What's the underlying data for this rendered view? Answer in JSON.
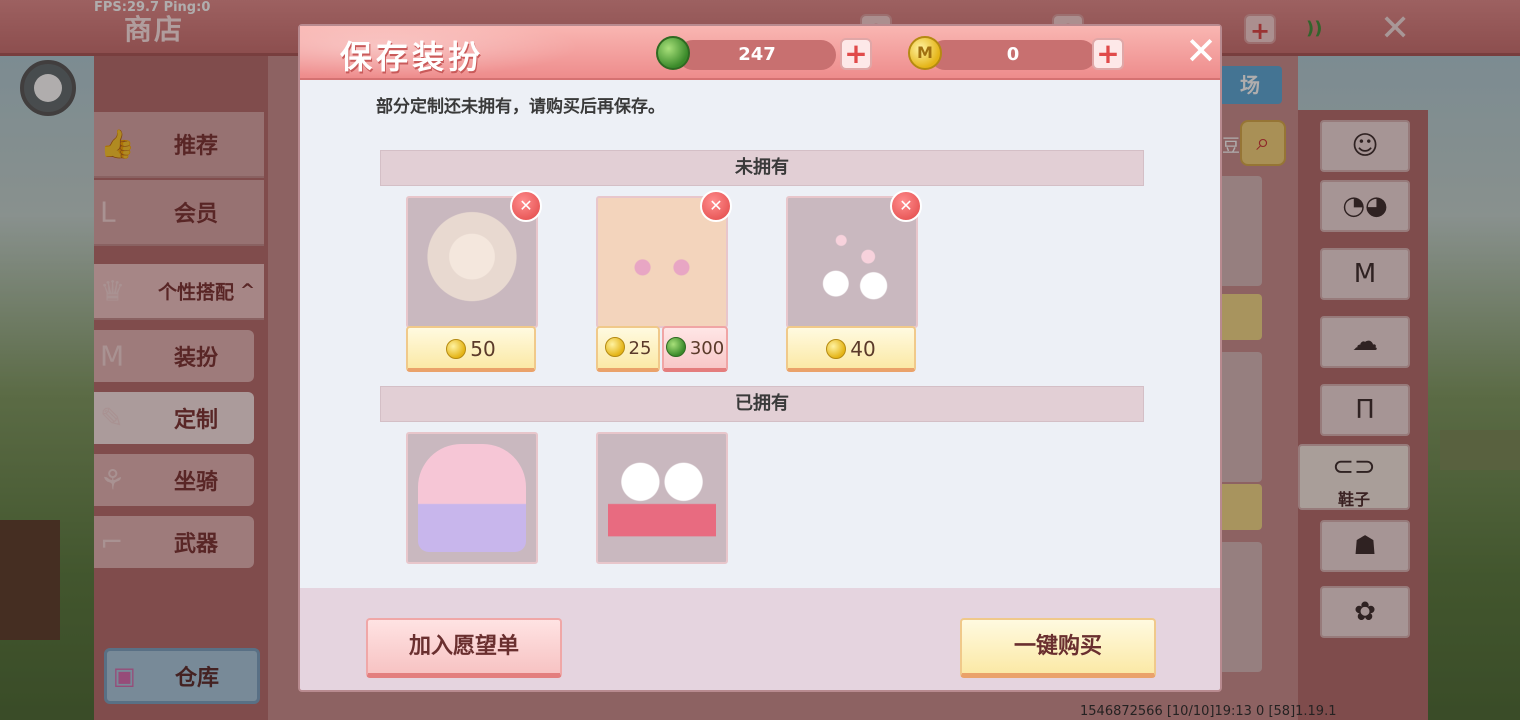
{
  "hud": {
    "fps_text": "FPS:29.7  Ping:0"
  },
  "shop": {
    "title": "商店",
    "sidebar": [
      {
        "label": "推荐",
        "icon": "thumbs-up-icon"
      },
      {
        "label": "会员",
        "icon": "vip-icon"
      },
      {
        "label": "个性搭配",
        "icon": "crown-icon",
        "expanded": true
      },
      {
        "label": "装扮",
        "icon": "shirt-icon"
      },
      {
        "label": "定制",
        "icon": "brush-icon"
      },
      {
        "label": "坐骑",
        "icon": "mount-icon"
      },
      {
        "label": "武器",
        "icon": "gun-icon"
      }
    ],
    "warehouse_label": "仓库",
    "tab_right": "场",
    "search_side_text": "豆",
    "categories": [
      {
        "icon": "face-icon"
      },
      {
        "icon": "mask-icon"
      },
      {
        "icon": "shirt-icon"
      },
      {
        "icon": "hair-icon"
      },
      {
        "icon": "pants-icon"
      },
      {
        "icon": "shoes-icon",
        "label": "鞋子",
        "active": true
      },
      {
        "icon": "backpack-icon"
      },
      {
        "icon": "paw-icon"
      }
    ],
    "status_text": "1546872566    [10/10]19:13 0      [58]1.19.1"
  },
  "modal": {
    "title": "保存装扮",
    "gems": "247",
    "coins": "0",
    "coin_symbol": "M",
    "hint": "部分定制还未拥有，请购买后再保存。",
    "not_owned_label": "未拥有",
    "owned_label": "已拥有",
    "not_owned_items": [
      {
        "name": "bunny-hair",
        "prices": [
          {
            "currency": "coin",
            "value": "50"
          }
        ]
      },
      {
        "name": "cute-face",
        "prices": [
          {
            "currency": "coin",
            "value": "25"
          },
          {
            "currency": "gem",
            "value": "300"
          }
        ]
      },
      {
        "name": "paw-effect",
        "prices": [
          {
            "currency": "coin",
            "value": "40"
          }
        ]
      }
    ],
    "owned_items": [
      {
        "name": "pink-dress"
      },
      {
        "name": "cat-shoes"
      }
    ],
    "wishlist_label": "加入愿望单",
    "buy_all_label": "一键购买"
  }
}
